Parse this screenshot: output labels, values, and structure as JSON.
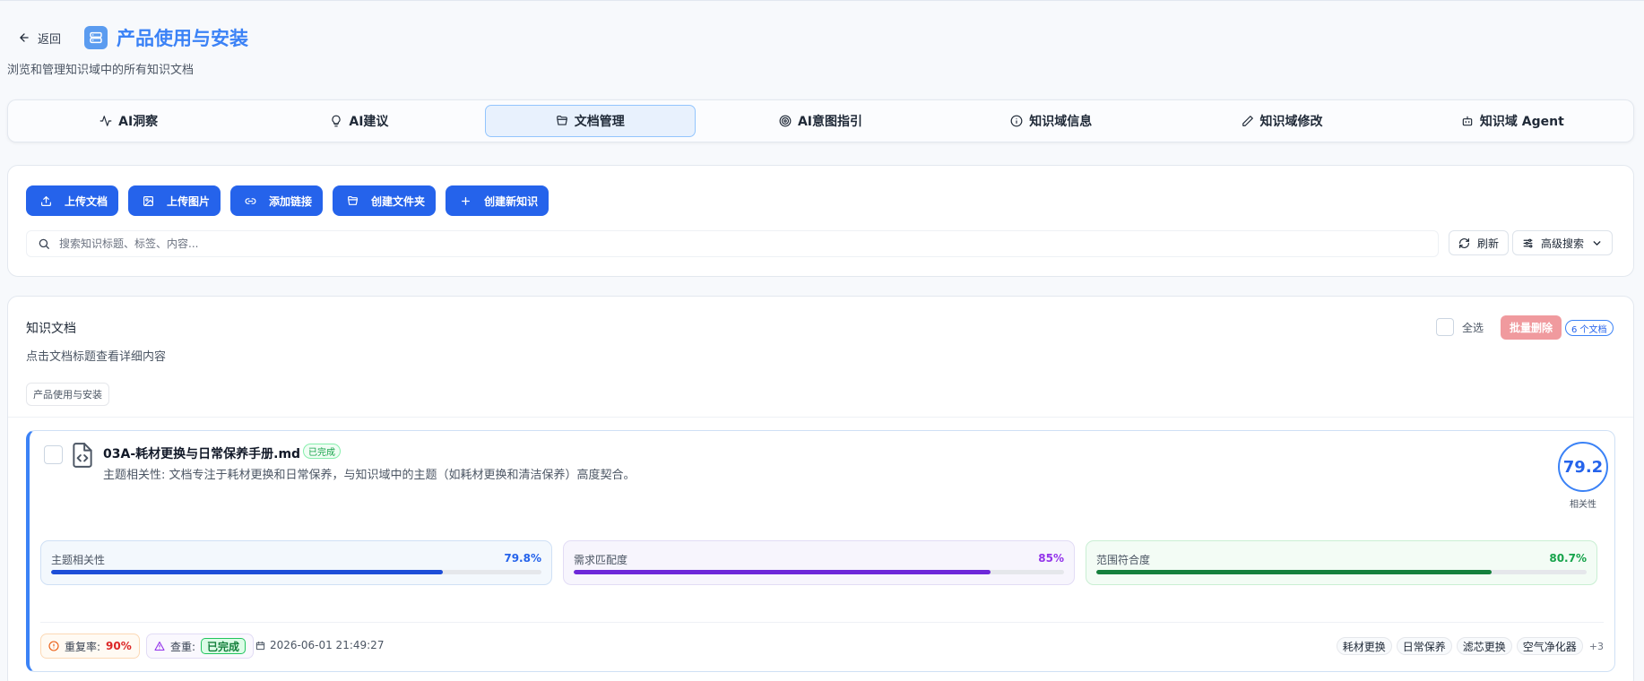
{
  "header": {
    "back_label": "返回",
    "title": "产品使用与安装",
    "subtitle": "浏览和管理知识域中的所有知识文档"
  },
  "tabs": [
    {
      "label": "AI洞察",
      "icon": "activity-icon",
      "active": false
    },
    {
      "label": "AI建议",
      "icon": "lightbulb-icon",
      "active": false
    },
    {
      "label": "文档管理",
      "icon": "folder-open-icon",
      "active": true
    },
    {
      "label": "AI意图指引",
      "icon": "target-icon",
      "active": false
    },
    {
      "label": "知识域信息",
      "icon": "info-icon",
      "active": false
    },
    {
      "label": "知识域修改",
      "icon": "pencil-icon",
      "active": false
    },
    {
      "label": "知识域 Agent",
      "icon": "bot-icon",
      "active": false
    }
  ],
  "actions": {
    "upload_doc": "上传文档",
    "upload_image": "上传图片",
    "add_link": "添加链接",
    "create_folder": "创建文件夹",
    "create_knowledge": "创建新知识",
    "search_placeholder": "搜索知识标题、标签、内容...",
    "refresh": "刷新",
    "advanced_search": "高级搜索"
  },
  "docs": {
    "title": "知识文档",
    "description": "点击文档标题查看详细内容",
    "domain_tag": "产品使用与安装",
    "select_all": "全选",
    "batch_delete": "批量删除",
    "count": "6 个文档",
    "items": [
      {
        "title": "03A-耗材更换与日常保养手册.md",
        "status": "已完成",
        "relevance_text": "主题相关性: 文档专注于耗材更换和日常保养，与知识域中的主题（如耗材更换和清洁保养）高度契合。",
        "score": "79.2",
        "score_label": "相关性",
        "metrics": [
          {
            "label": "主题相关性",
            "value": "79.8%",
            "fraction": 0.798
          },
          {
            "label": "需求匹配度",
            "value": "85%",
            "fraction": 0.85
          },
          {
            "label": "范围符合度",
            "value": "80.7%",
            "fraction": 0.807
          }
        ],
        "dup_label": "重复率:",
        "dup_value": "90%",
        "check_label": "查重:",
        "check_value": "已完成",
        "date": "2026-06-01 21:49:27",
        "tags": [
          "耗材更换",
          "日常保养",
          "滤芯更换",
          "空气净化器"
        ],
        "more_tags": "+3"
      }
    ]
  },
  "colors": {
    "primary": "#2563eb",
    "accent_title": "#3b82f6",
    "danger_soft": "#f09a9e",
    "success": "#16a34a",
    "purple": "#9333ea"
  }
}
